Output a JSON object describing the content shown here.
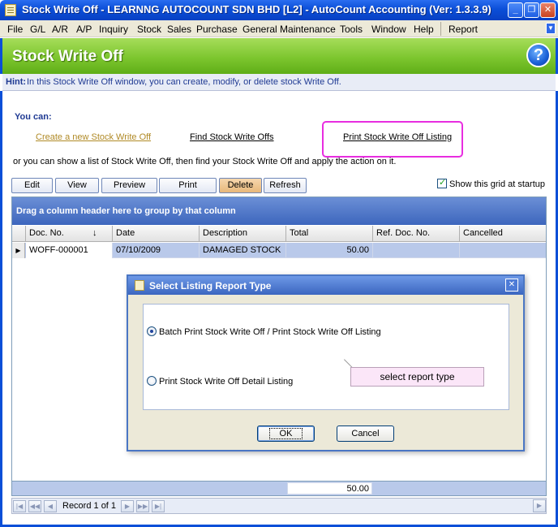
{
  "window": {
    "title": "Stock Write Off - LEARNNG AUTOCOUNT SDN BHD [L2] - AutoCount Accounting (Ver: 1.3.3.9)",
    "minimize_label": "_",
    "restore_label": "❐",
    "close_label": "✕"
  },
  "menu": {
    "items": [
      "File",
      "G/L",
      "A/R",
      "A/P",
      "Inquiry",
      "Stock",
      "Sales",
      "Purchase",
      "General Maintenance",
      "Tools",
      "Window",
      "Help",
      "Report"
    ],
    "overflow_label": "▼"
  },
  "header": {
    "title": "Stock Write Off",
    "help_label": "?"
  },
  "hint": {
    "label": "Hint:",
    "text": "In this Stock Write Off window, you can create, modify, or delete stock Write Off."
  },
  "actions": {
    "you_can": "You can:",
    "create_link": "Create a new Stock Write Off",
    "find_link": "Find Stock Write Offs",
    "print_link": "Print Stock Write Off Listing",
    "or_text": "or you can show a list of Stock Write Off, then find your Stock Write Off and apply the action on it."
  },
  "toolbar": {
    "edit": "Edit",
    "view": "View",
    "preview": "Preview",
    "print": "Print",
    "delete": "Delete",
    "refresh": "Refresh",
    "show_grid": "Show this grid at startup"
  },
  "grid": {
    "group_hint": "Drag a column header here to group by that column",
    "columns": [
      "Doc. No.",
      "Date",
      "Description",
      "Total",
      "Ref. Doc. No.",
      "Cancelled"
    ],
    "sort_icon": "↓",
    "rows": [
      {
        "indicator": "▶",
        "doc_no": "WOFF-000001",
        "date": "07/10/2009",
        "description": "DAMAGED STOCK",
        "total": "50.00",
        "ref_doc_no": "",
        "cancelled": ""
      }
    ],
    "footer_total": "50.00",
    "nav_record": "Record 1 of 1"
  },
  "dialog": {
    "title": "Select Listing Report Type",
    "close_label": "✕",
    "option1": "Batch Print Stock Write Off / Print Stock Write Off Listing",
    "option2": "Print Stock Write Off Detail Listing",
    "selected": "option1",
    "ok": "OK",
    "cancel": "Cancel"
  },
  "callout": {
    "text": "select report type"
  },
  "colors": {
    "title_bar": "#0b4fd8",
    "header_green": "#7dc62f",
    "highlight_magenta": "#e82de0",
    "selected_row": "#b9c9ea"
  }
}
